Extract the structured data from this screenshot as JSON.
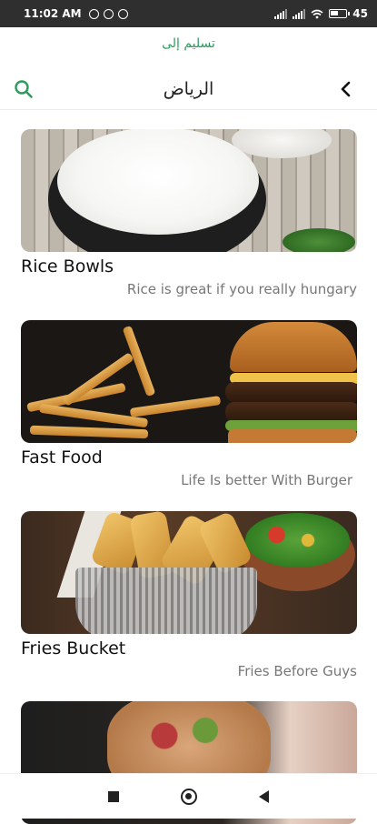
{
  "status_bar": {
    "time": "11:02 AM",
    "battery": "45"
  },
  "header": {
    "deliver_to": "تسليم إلى",
    "city": "الرياض",
    "search_icon": "search-icon",
    "back_icon": "chevron-left-icon"
  },
  "categories": [
    {
      "title": "Rice Bowls",
      "subtitle": "Rice is great if you really hungary"
    },
    {
      "title": "Fast Food",
      "subtitle": "Life Is better With Burger"
    },
    {
      "title": "Fries Bucket",
      "subtitle": "Fries Before Guys"
    },
    {
      "title": "",
      "subtitle": ""
    }
  ],
  "colors": {
    "accent": "#2e9b5e",
    "status_bar": "#2f2f2f"
  },
  "nav": {
    "recent_icon": "square-icon",
    "home_icon": "circle-icon",
    "back_icon": "triangle-back-icon"
  }
}
